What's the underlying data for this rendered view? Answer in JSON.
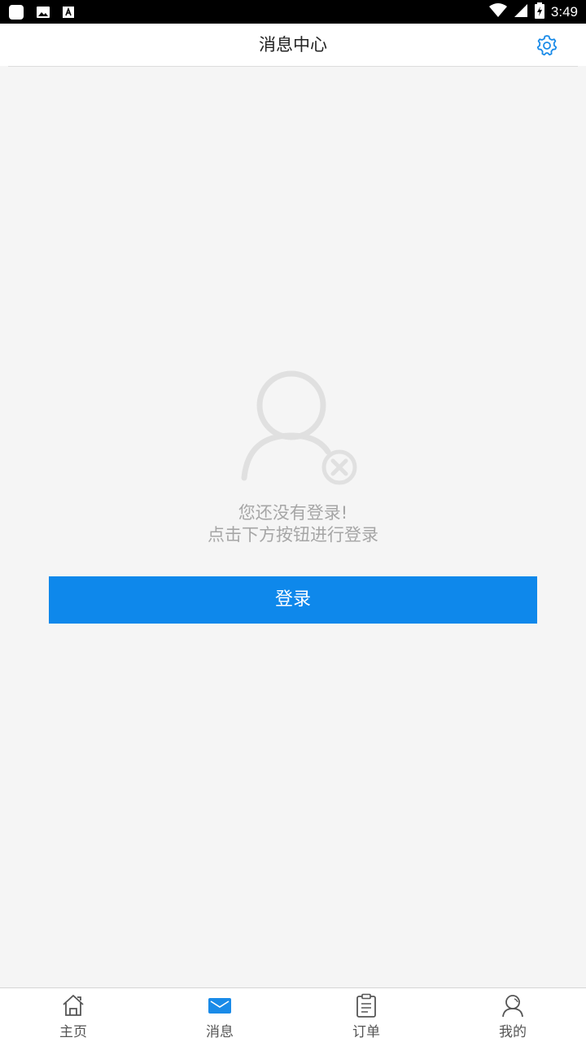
{
  "status_bar": {
    "time": "3:49",
    "icons": [
      "app-square-icon",
      "image-icon",
      "font-a-icon",
      "wifi-icon",
      "signal-icon",
      "battery-icon"
    ]
  },
  "header": {
    "title": "消息中心",
    "settings_icon": "gear-icon"
  },
  "empty_state": {
    "icon": "user-not-logged-in-icon",
    "line1": "您还没有登录!",
    "line2": "点击下方按钮进行登录"
  },
  "login_button": {
    "label": "登录"
  },
  "tabs": [
    {
      "label": "主页",
      "icon": "home-icon",
      "active": false
    },
    {
      "label": "消息",
      "icon": "mail-icon",
      "active": true
    },
    {
      "label": "订单",
      "icon": "clipboard-icon",
      "active": false
    },
    {
      "label": "我的",
      "icon": "user-icon",
      "active": false
    }
  ],
  "colors": {
    "accent": "#0e88eb",
    "background": "#f5f5f5",
    "muted_text": "#a6a6a6"
  }
}
